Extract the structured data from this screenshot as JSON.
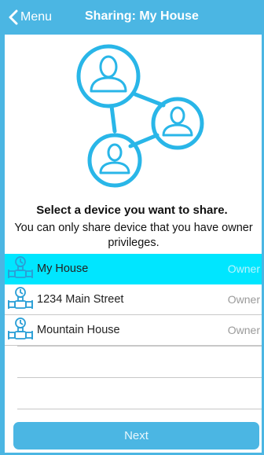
{
  "header": {
    "back_label": "Menu",
    "title": "Sharing: My House"
  },
  "main": {
    "prompt": "Select a device you want to share.",
    "description": "You can only share device that you have owner privileges."
  },
  "devices": [
    {
      "name": "My House",
      "role": "Owner",
      "selected": true
    },
    {
      "name": "1234 Main Street",
      "role": "Owner",
      "selected": false
    },
    {
      "name": "Mountain House",
      "role": "Owner",
      "selected": false
    }
  ],
  "footer": {
    "next_label": "Next"
  },
  "colors": {
    "accent": "#4bb6e3",
    "selected_row": "#00e6ff"
  },
  "icons": {
    "back": "chevron-left-icon",
    "device": "water-valve-icon",
    "illustration": "shared-users-icon"
  }
}
